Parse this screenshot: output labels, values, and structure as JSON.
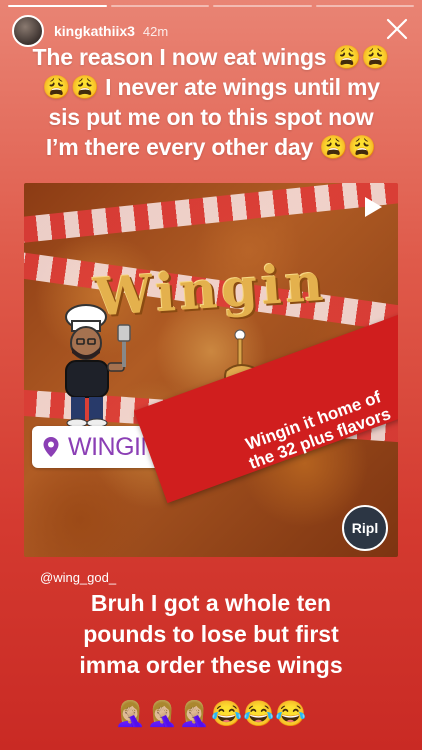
{
  "story": {
    "progress_segments": 4,
    "active_segment": 0
  },
  "header": {
    "username": "kingkathiix3",
    "time": "42m",
    "close_icon": "close-icon"
  },
  "caption": {
    "line1": "The reason I now eat wings 😩😩",
    "line2": "😩😩 I never ate wings until my",
    "line3": "sis put me on to this spot now",
    "line4": "I’m there every other day 😩😩"
  },
  "post": {
    "wordmark": "Wingin",
    "play_icon": "play-icon",
    "location": "WINGIN IT",
    "location_icon": "location-pin-icon",
    "banner_line1": "Wingin it home of",
    "banner_line2": "the 32 plus flavors",
    "badge": "Ripl"
  },
  "mention": "@wing_god_",
  "bottom_caption": {
    "line1": "Bruh I got a whole ten",
    "line2": "pounds to lose but first",
    "line3": "imma order these wings",
    "emojis": "🤦🏼‍♀️🤦🏼‍♀️🤦🏼‍♀️😂😂😂"
  },
  "colors": {
    "background_top": "#e98474",
    "background_bottom": "#c92a24",
    "location_text": "#8b3fb5",
    "banner": "#d01e1e",
    "ripl_badge": "#2c3644"
  }
}
